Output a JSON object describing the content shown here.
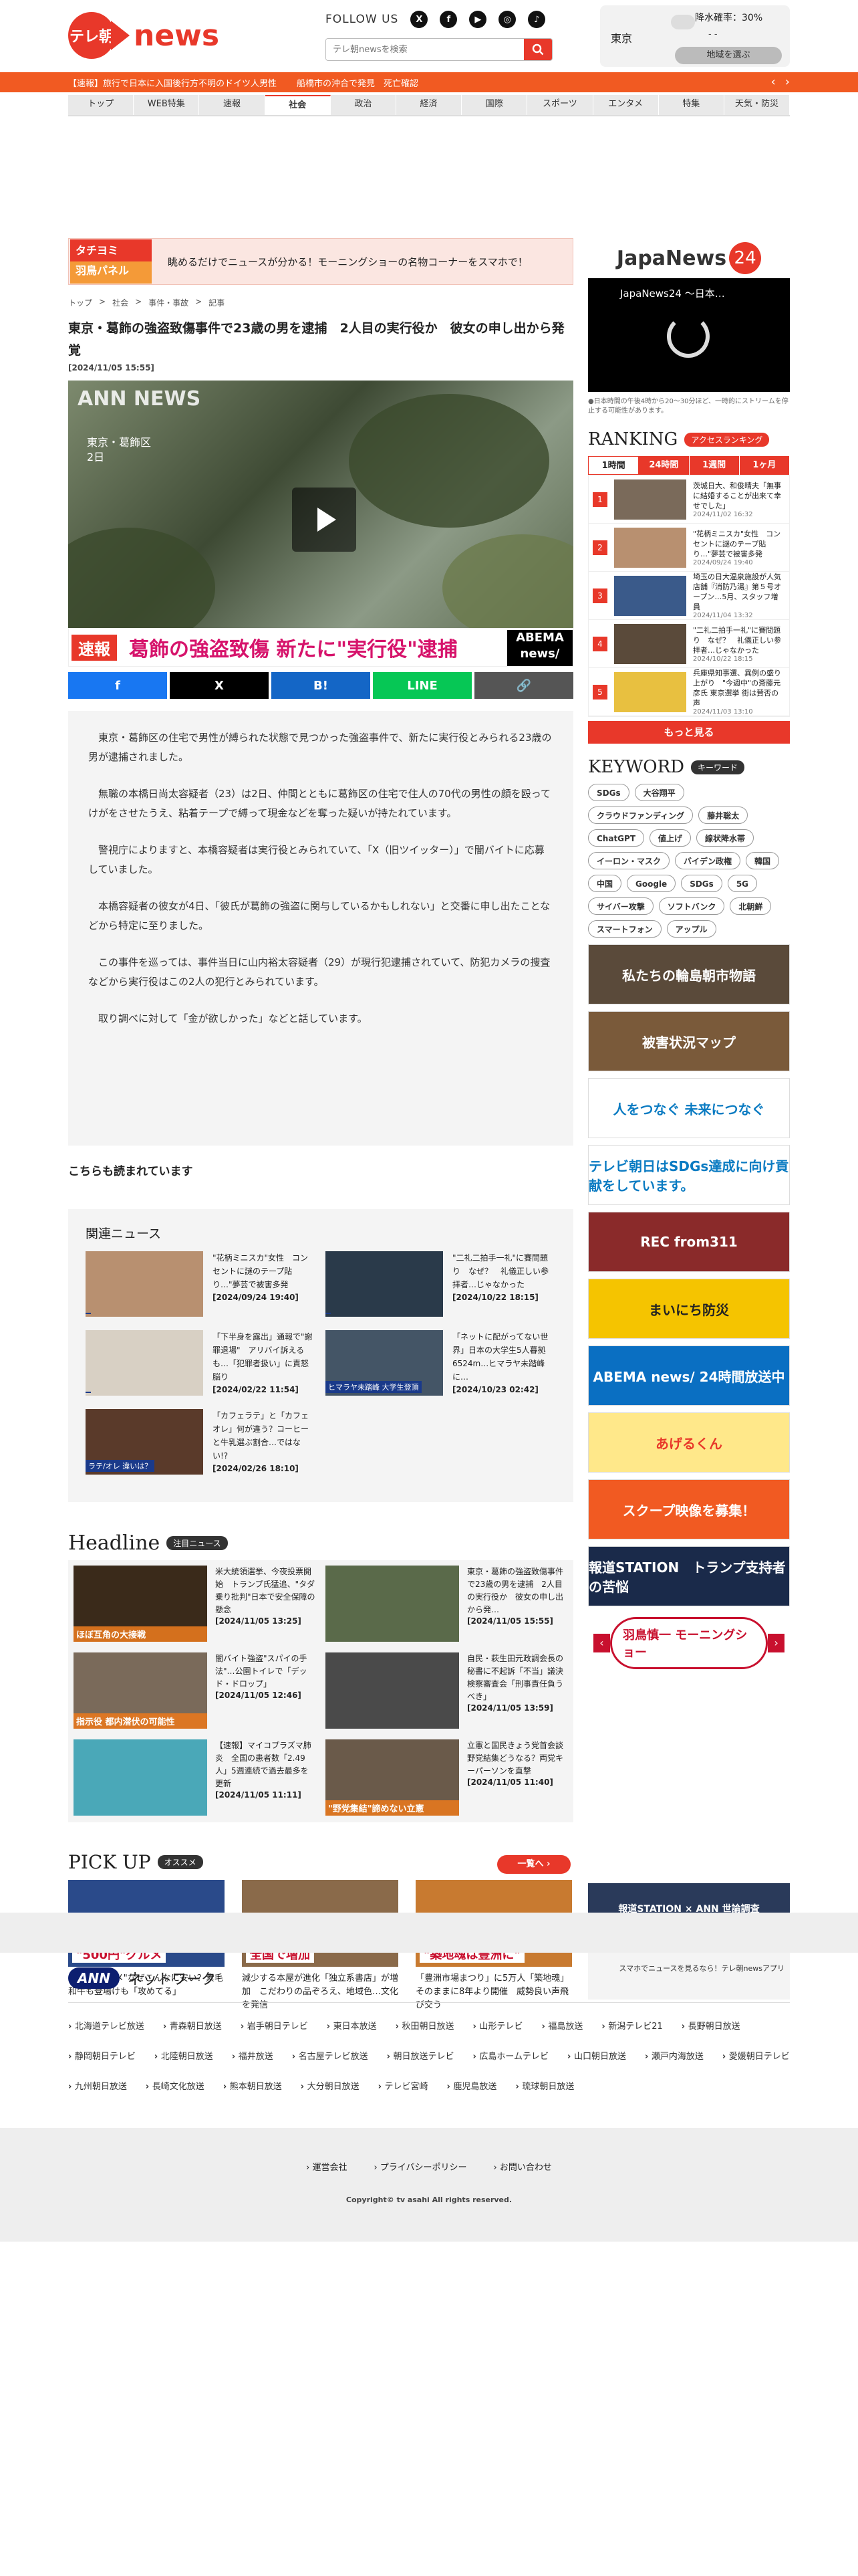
{
  "header": {
    "logo_badge": "テレ朝",
    "logo_text": "news",
    "follow_label": "FOLLOW US",
    "search_placeholder": "テレ朝newsを検索",
    "weather_city": "東京",
    "weather_rain": "降水確率：30%",
    "weather_temp": "- -",
    "weather_button": "地域を選ぶ"
  },
  "breaking": {
    "items": [
      "【速報】旅行で日本に入国後行方不明のドイツ人男性",
      "船橋市の沖合で発見　死亡確認"
    ]
  },
  "nav": {
    "items": [
      "トップ",
      "WEB特集",
      "速報",
      "社会",
      "政治",
      "経済",
      "国際",
      "スポーツ",
      "エンタメ",
      "特集",
      "天気・防災"
    ],
    "active_index": 3
  },
  "promo": {
    "image_text_1": "タチヨミ",
    "image_text_2": "羽鳥パネル",
    "text": "眺めるだけでニュースが分かる！モーニングショーの名物コーナーをスマホで！"
  },
  "breadcrumb": [
    "トップ",
    "社会",
    "事件・事故",
    "記事"
  ],
  "article": {
    "title": "東京・葛飾の強盗致傷事件で23歳の男を逮捕　2人目の実行役か　彼女の申し出から発覚",
    "date": "[2024/11/05 15:55]",
    "photo_logo": "ANN NEWS",
    "photo_location_1": "東京・葛飾区",
    "photo_location_2": "2日",
    "caption_flag": "速報",
    "caption_text": "葛飾の強盗致傷 新たに\"実行役\"逮捕",
    "caption_abema": "ABEMA news/",
    "paragraphs": [
      "東京・葛飾区の住宅で男性が縛られた状態で見つかった強盗事件で、新たに実行役とみられる23歳の男が逮捕されました。",
      "無職の本橋日尚太容疑者（23）は2日、仲間とともに葛飾区の住宅で住人の70代の男性の顔を殴ってけがをさせたうえ、粘着テープで縛って現金などを奪った疑いが持たれています。",
      "警視庁によりますと、本橋容疑者は実行役とみられていて、「X（旧ツイッター）」で闇バイトに応募していました。",
      "本橋容疑者の彼女が4日、「彼氏が葛飾の強盗に関与しているかもしれない」と交番に申し出たことなどから特定に至りました。",
      "この事件を巡っては、事件当日に山内裕太容疑者（29）が現行犯逮捕されていて、防犯カメラの捜査などから実行役はこの2人の犯行とみられています。",
      "取り調べに対して「金が欲しかった」などと話しています。"
    ]
  },
  "share": [
    {
      "label": "f",
      "color": "#1877f2"
    },
    {
      "label": "X",
      "color": "#000000"
    },
    {
      "label": "B!",
      "color": "#1466c6"
    },
    {
      "label": "LINE",
      "color": "#06c755"
    },
    {
      "label": "🔗",
      "color": "#555555"
    }
  ],
  "also_read": "こちらも読まれています",
  "related": {
    "title": "関連ニュース",
    "items": [
      {
        "title": "\"花柄ミニスカ\"女性　コンセントに謎のテープ貼り…\"夢芸で被害多発",
        "date": "[2024/09/24 19:40]"
      },
      {
        "title": "\"二礼二拍手一礼\"に賽問題り　なぜ？　礼儀正しい参拝者…じゃなかった",
        "date": "[2024/10/22 18:15]"
      },
      {
        "title": "「下半身を露出」通報で\"謝罪退場\"　アリバイ訴えるも…「犯罪者扱い」に責怒脳り",
        "date": "[2024/02/22 11:54]"
      },
      {
        "title": "「ネットに配がってない世界」日本の大学生5人暮拠6524m…ヒマラヤ未踏峰に…",
        "date": "[2024/10/23 02:42]"
      },
      {
        "title": "「カフェラテ」と「カフェオレ」何が違う？コーヒーと牛乳選ぶ割合…ではない!?",
        "date": "[2024/02/26 18:10]"
      }
    ],
    "thumb_labels": [
      "",
      "",
      "",
      "ヒマラヤ未踏峰 大学生登頂",
      "ラテ/オレ 違いは？"
    ]
  },
  "headline": {
    "title": "Headline",
    "badge": "注目ニュース",
    "items": [
      {
        "title": "米大統領選挙、今夜投票開始　トランプ氏猛追、\"タダ乗り批判\"日本で安全保障の懸念",
        "date": "[2024/11/05 13:25]",
        "thumb": "ほぼ互角の大接戦"
      },
      {
        "title": "東京・葛飾の強盗致傷事件で23歳の男を逮捕　2人目の実行役か　彼女の申し出から発…",
        "date": "[2024/11/05 15:55]",
        "thumb": ""
      },
      {
        "title": "闇バイト強盗\"スパイの手法\"…公園トイレで「デッド・ドロップ」",
        "date": "[2024/11/05 12:46]",
        "thumb": "指示役 都内潜伏の可能性"
      },
      {
        "title": "自民・萩生田元政調会長の秘書に不起訴「不当」議決　検察審査会「刑事責任負うべき」",
        "date": "[2024/11/05 13:59]",
        "thumb": ""
      },
      {
        "title": "【速報】マイコプラズマ肺炎　全国の患者数「2.49人」5週連続で過去最多を更新",
        "date": "[2024/11/05 11:11]",
        "thumb": ""
      },
      {
        "title": "立憲と国民きょう党首会談　野党結集どうなる？両党キーパーソンを直撃",
        "date": "[2024/11/05 11:40]",
        "thumb": "\"野党集結\"諦めない立憲"
      }
    ]
  },
  "sidebar": {
    "jn24_title": "JapaNews",
    "jn24_num": "24",
    "video_label": "JapaNews24 ～日本…",
    "video_note": "●日本時間の午後4時から20～30分ほど、一時的にストリームを停止する可能性があります。",
    "ranking_title": "RANKING",
    "ranking_badge": "アクセスランキング",
    "ranking_tabs": [
      "1時間",
      "24時間",
      "1週間",
      "1ヶ月"
    ],
    "ranking": [
      {
        "num": "1",
        "title": "茨城日大、和俊晴夫「無事に結婚することが出来て幸せでした」",
        "time": "2024/11/02 16:32"
      },
      {
        "num": "2",
        "title": "\"花柄ミニスカ\"女性　コンセントに謎のテープ貼り…\"夢芸で被害多発",
        "time": "2024/09/24 19:40"
      },
      {
        "num": "3",
        "title": "埼玉の日大温泉施設が人気店舗『消防乃湯』第５号オープン…5月、スタッフ増員",
        "time": "2024/11/04 13:32"
      },
      {
        "num": "4",
        "title": "\"二礼二拍手一礼\"に賽問題り　なぜ？　礼儀正しい参拝者…じゃなかった",
        "time": "2024/10/22 18:15"
      },
      {
        "num": "5",
        "title": "兵庫県知事選、異例の盛り上がり　\"今週中\"の斎藤元彦氏 東京選挙 街は賛否の声",
        "time": "2024/11/03 13:10"
      }
    ],
    "more": "もっと見る",
    "keyword_title": "KEYWORD",
    "keyword_badge": "キーワード",
    "keywords": [
      "SDGs",
      "大谷翔平",
      "クラウドファンディング",
      "藤井聡太",
      "ChatGPT",
      "値上げ",
      "線状降水帯",
      "イーロン・マスク",
      "バイデン政権",
      "韓国",
      "中国",
      "Google",
      "SDGs",
      "5G",
      "サイバー攻撃",
      "ソフトバンク",
      "北朝鮮",
      "スマートフォン",
      "アップル"
    ],
    "banners": [
      {
        "text": "私たちの輪島朝市物語",
        "bg": "#5a4a3a",
        "fg": "#ffffff"
      },
      {
        "text": "被害状況マップ",
        "bg": "#7a5a3a",
        "fg": "#ffffff"
      },
      {
        "text": "人をつなぐ 未来につなぐ",
        "bg": "#ffffff",
        "fg": "#0a7bc2"
      },
      {
        "text": "テレビ朝日はSDGs達成に向け貢献をしています。",
        "bg": "#ffffff",
        "fg": "#0a7bc2"
      },
      {
        "text": "REC from311",
        "bg": "#8a2a2a",
        "fg": "#ffffff"
      },
      {
        "text": "まいにち防災",
        "bg": "#f5c400",
        "fg": "#222222"
      },
      {
        "text": "ABEMA news/ 24時間放送中",
        "bg": "#0a6fc2",
        "fg": "#ffffff"
      },
      {
        "text": "あげるくん",
        "bg": "#ffe88a",
        "fg": "#e8382a"
      },
      {
        "text": "スクープ映像を募集！",
        "bg": "#f15a22",
        "fg": "#ffffff"
      },
      {
        "text": "報道STATION　トランプ支持者の苦悩",
        "bg": "#1a2a4a",
        "fg": "#ffffff"
      }
    ],
    "morning_show": "羽鳥慎一 モーニングショー"
  },
  "pickup": {
    "title": "PICK UP",
    "badge": "オススメ",
    "more": "一覧へ ›",
    "items": [
      {
        "title": "\"500円グルメ\"なぜこんなに安い？素毛和牛も登場けも「攻めてる」",
        "thumb": "\"500円\"グルメ"
      },
      {
        "title": "減少する本屋が進化「独立系書店」が増加　こだわりの品ぞろえ、地域色…文化を発信",
        "thumb": "全国で増加"
      },
      {
        "title": "「豊洲市場まつり」に5万人「築地魂」そのままに8年より開催　威勢良い声飛び交う",
        "thumb": "\"築地魂は豊洲に\""
      }
    ],
    "side_top": "報道STATION × ANN 世論調査",
    "side_bottom": "スマホでニュースを見るなら！テレ朝newsアプリ"
  },
  "network": {
    "pill": "ANN",
    "title": "ネットワーク",
    "stations": [
      "北海道テレビ放送",
      "青森朝日放送",
      "岩手朝日テレビ",
      "東日本放送",
      "秋田朝日放送",
      "山形テレビ",
      "福島放送",
      "新潟テレビ21",
      "長野朝日放送",
      "静岡朝日テレビ",
      "北陸朝日放送",
      "福井放送",
      "名古屋テレビ放送",
      "朝日放送テレビ",
      "広島ホームテレビ",
      "山口朝日放送",
      "瀬戸内海放送",
      "愛媛朝日テレビ",
      "九州朝日放送",
      "長崎文化放送",
      "熊本朝日放送",
      "大分朝日放送",
      "テレビ宮崎",
      "鹿児島放送",
      "琉球朝日放送"
    ]
  },
  "footer": {
    "links": [
      "運営会社",
      "プライバシーポリシー",
      "お問い合わせ"
    ],
    "copyright": "Copyright© tv asahi All rights reserved."
  }
}
